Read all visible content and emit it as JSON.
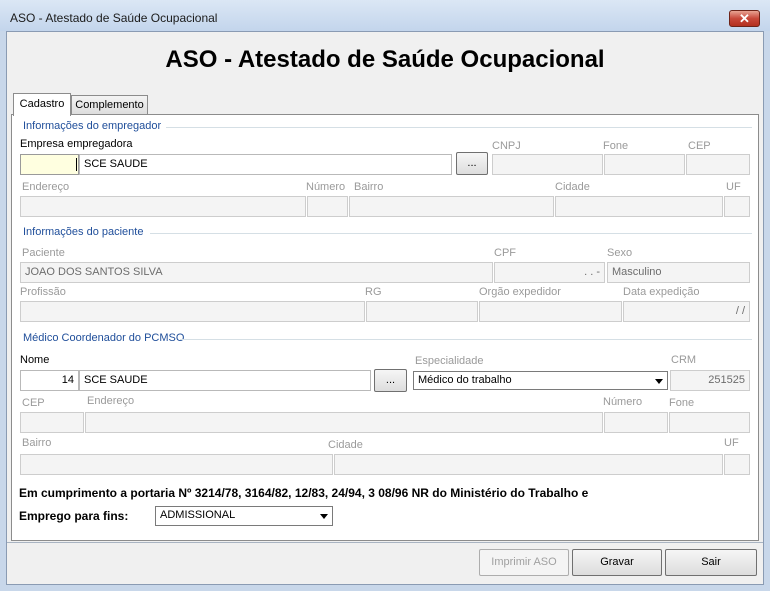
{
  "window": {
    "title": "ASO - Atestado de Saúde Ocupacional",
    "close_glyph": "✕"
  },
  "header": {
    "title": "ASO - Atestado de Saúde Ocupacional"
  },
  "tabs": [
    {
      "label": "Cadastro",
      "active": true
    },
    {
      "label": "Complemento",
      "active": false
    }
  ],
  "empregador": {
    "section_title": "Informações do empregador",
    "empresa_label": "Empresa empregadora",
    "empresa_code": "",
    "empresa_name": "SCE SAUDE",
    "lookup_button": "...",
    "cnpj_label": "CNPJ",
    "cnpj": "",
    "fone_label": "Fone",
    "fone": "",
    "cep_label": "CEP",
    "cep": "",
    "endereco_label": "Endereço",
    "endereco": "",
    "numero_label": "Número",
    "numero": "",
    "bairro_label": "Bairro",
    "bairro": "",
    "cidade_label": "Cidade",
    "cidade": "",
    "uf_label": "UF",
    "uf": ""
  },
  "paciente": {
    "section_title": "Informações do paciente",
    "paciente_label": "Paciente",
    "paciente": "JOAO DOS SANTOS SILVA",
    "cpf_label": "CPF",
    "cpf": ". . -",
    "sexo_label": "Sexo",
    "sexo": "Masculino",
    "profissao_label": "Profissão",
    "profissao": "",
    "rg_label": "RG",
    "rg": "",
    "orgao_label": "Orgão expedidor",
    "orgao": "",
    "data_exp_label": "Data expedição",
    "data_exp": "/ /"
  },
  "medico": {
    "section_title": "Médico Coordenador do PCMSO",
    "nome_label": "Nome",
    "nome_code": "14",
    "nome": "SCE SAUDE",
    "lookup_button": "...",
    "especialidade_label": "Especialidade",
    "especialidade": "Médico do trabalho",
    "crm_label": "CRM",
    "crm": "251525",
    "cep_label": "CEP",
    "cep": "",
    "endereco_label": "Endereço",
    "endereco": "",
    "numero_label": "Número",
    "numero": "",
    "fone_label": "Fone",
    "fone": "",
    "bairro_label": "Bairro",
    "bairro": "",
    "cidade_label": "Cidade",
    "cidade": "",
    "uf_label": "UF",
    "uf": ""
  },
  "portaria": {
    "text": "Em cumprimento a portaria Nº 3214/78, 3164/82, 12/83, 24/94, 3 08/96 NR do Ministério do Trabalho e",
    "emprego_label": "Emprego para fins:",
    "emprego_value": "ADMISSIONAL"
  },
  "footer": {
    "imprimir": "Imprimir ASO",
    "gravar": "Gravar",
    "sair": "Sair"
  }
}
